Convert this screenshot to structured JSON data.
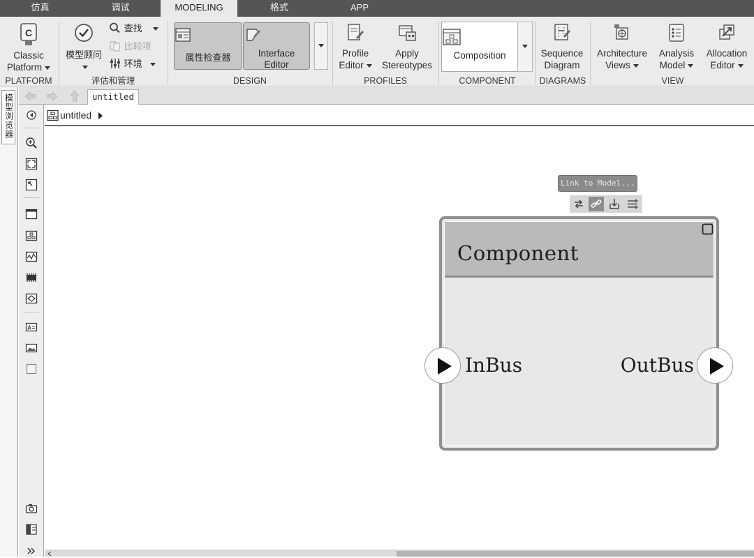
{
  "menu": {
    "tabs": [
      {
        "label": "仿真"
      },
      {
        "label": "调试"
      },
      {
        "label": "MODELING"
      },
      {
        "label": "格式"
      },
      {
        "label": "APP"
      }
    ]
  },
  "ribbon": {
    "platform": {
      "classic_platform_line1": "Classic",
      "classic_platform_line2": "Platform",
      "group_label": "PLATFORM"
    },
    "evaluate": {
      "model_advisor": "模型顾问",
      "find": "查找",
      "compare": "比较项",
      "environment": "环境",
      "group_label": "评估和管理"
    },
    "design": {
      "property_inspector": "属性检查器",
      "interface_editor_line1": "Interface",
      "interface_editor_line2": "Editor",
      "group_label": "DESIGN"
    },
    "profiles": {
      "profile_editor_line1": "Profile",
      "profile_editor_line2": "Editor",
      "apply_stereotypes_line1": "Apply",
      "apply_stereotypes_line2": "Stereotypes",
      "group_label": "PROFILES"
    },
    "component": {
      "composition": "Composition",
      "group_label": "COMPONENT"
    },
    "diagrams": {
      "sequence_line1": "Sequence",
      "sequence_line2": "Diagram",
      "group_label": "DIAGRAMS"
    },
    "view": {
      "architecture_line1": "Architecture",
      "architecture_line2": "Views",
      "analysis_line1": "Analysis",
      "analysis_line2": "Model",
      "allocation_line1": "Allocation",
      "allocation_line2": "Editor",
      "group_label": "VIEW"
    }
  },
  "browser": {
    "tab_label": "模型浏览器"
  },
  "tabbar": {
    "doc_tab": "untitled"
  },
  "breadcrumb": {
    "model_name": "untitled"
  },
  "canvas": {
    "link_to_model": "Link to Model...",
    "component": {
      "title": "Component",
      "in_port": "InBus",
      "out_port": "OutBus"
    }
  },
  "colors": {
    "menubar": "#555555",
    "ribbon": "#ebebeb",
    "component_header": "#bababa",
    "component_body": "#e8e8e8",
    "component_border": "#8f8f8f"
  }
}
